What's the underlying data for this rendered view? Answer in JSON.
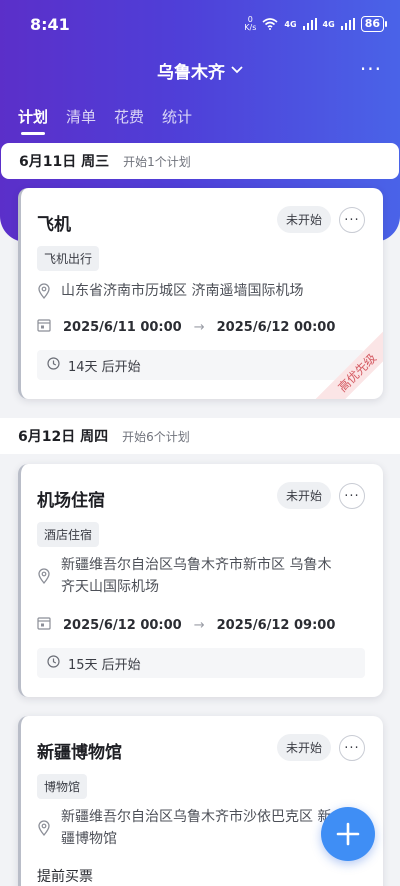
{
  "status_bar": {
    "time": "8:41",
    "speed": "0",
    "speed_unit": "K/s",
    "net1": "4G",
    "net2": "4G",
    "battery": "86"
  },
  "header": {
    "city": "乌鲁木齐",
    "more_label": "···"
  },
  "tabs": [
    {
      "label": "计划",
      "active": true
    },
    {
      "label": "清单",
      "active": false
    },
    {
      "label": "花费",
      "active": false
    },
    {
      "label": "统计",
      "active": false
    }
  ],
  "days": [
    {
      "date": "6月11日 周三",
      "count": "开始1个计划",
      "cards": [
        {
          "title": "飞机",
          "status": "未开始",
          "tag": "飞机出行",
          "location": "山东省济南市历城区 济南遥墙国际机场",
          "start": "2025/6/11 00:00",
          "end": "2025/6/12 00:00",
          "countdown": "14天 后开始",
          "priority": "高优先级"
        }
      ]
    },
    {
      "date": "6月12日 周四",
      "count": "开始6个计划",
      "cards": [
        {
          "title": "机场住宿",
          "status": "未开始",
          "tag": "酒店住宿",
          "location_line1": "新疆维吾尔自治区乌鲁木齐市新市区 乌鲁木",
          "location_line2": "齐天山国际机场",
          "start": "2025/6/12 00:00",
          "end": "2025/6/12 09:00",
          "countdown": "15天 后开始"
        },
        {
          "title": "新疆博物馆",
          "status": "未开始",
          "tag": "博物馆",
          "location_line1": "新疆维吾尔自治区乌鲁木齐市沙依巴克区 新",
          "location_line2": "疆博物馆",
          "note": "提前买票"
        }
      ]
    }
  ],
  "colors": {
    "header_gradient_start": "#5b2fc9",
    "header_gradient_end": "#4a63e8",
    "fab": "#3f8ef5",
    "priority_text": "#d45a62",
    "priority_bg": "#fbe5e6"
  },
  "icons": [
    "chevron-down-icon",
    "more-icon",
    "location-pin-icon",
    "calendar-icon",
    "arrow-right-icon",
    "clock-icon",
    "plus-icon"
  ]
}
